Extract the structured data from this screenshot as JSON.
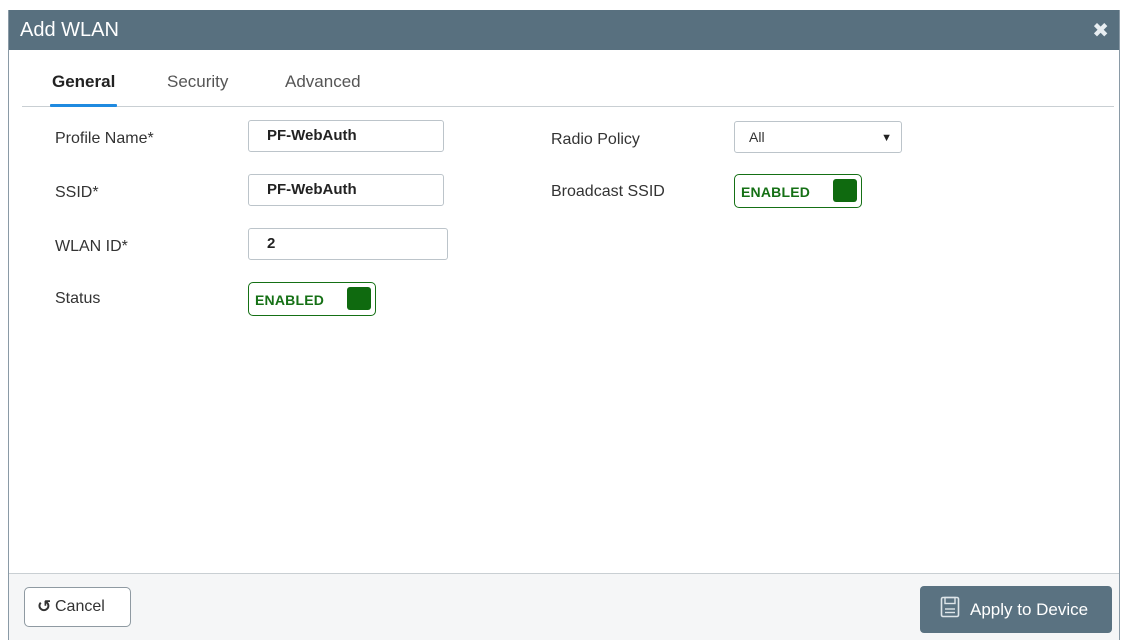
{
  "dialog": {
    "title": "Add WLAN",
    "close_icon": "close-icon"
  },
  "tabs": [
    {
      "label": "General",
      "active": true
    },
    {
      "label": "Security",
      "active": false
    },
    {
      "label": "Advanced",
      "active": false
    }
  ],
  "form": {
    "profile_name_label": "Profile Name*",
    "profile_name_value": "PF-WebAuth",
    "ssid_label": "SSID*",
    "ssid_value": "PF-WebAuth",
    "wlan_id_label": "WLAN ID*",
    "wlan_id_value": "2",
    "status_label": "Status",
    "status_toggle": "ENABLED",
    "radio_policy_label": "Radio Policy",
    "radio_policy_value": "All",
    "broadcast_ssid_label": "Broadcast SSID",
    "broadcast_ssid_toggle": "ENABLED"
  },
  "footer": {
    "cancel_label": "Cancel",
    "cancel_icon": "undo-icon",
    "apply_label": "Apply to Device",
    "apply_icon": "save-icon"
  },
  "colors": {
    "titlebar": "#58707f",
    "accent_tab": "#1f8ae0",
    "toggle_green": "#0f6a0f",
    "apply_button": "#5a7281"
  }
}
